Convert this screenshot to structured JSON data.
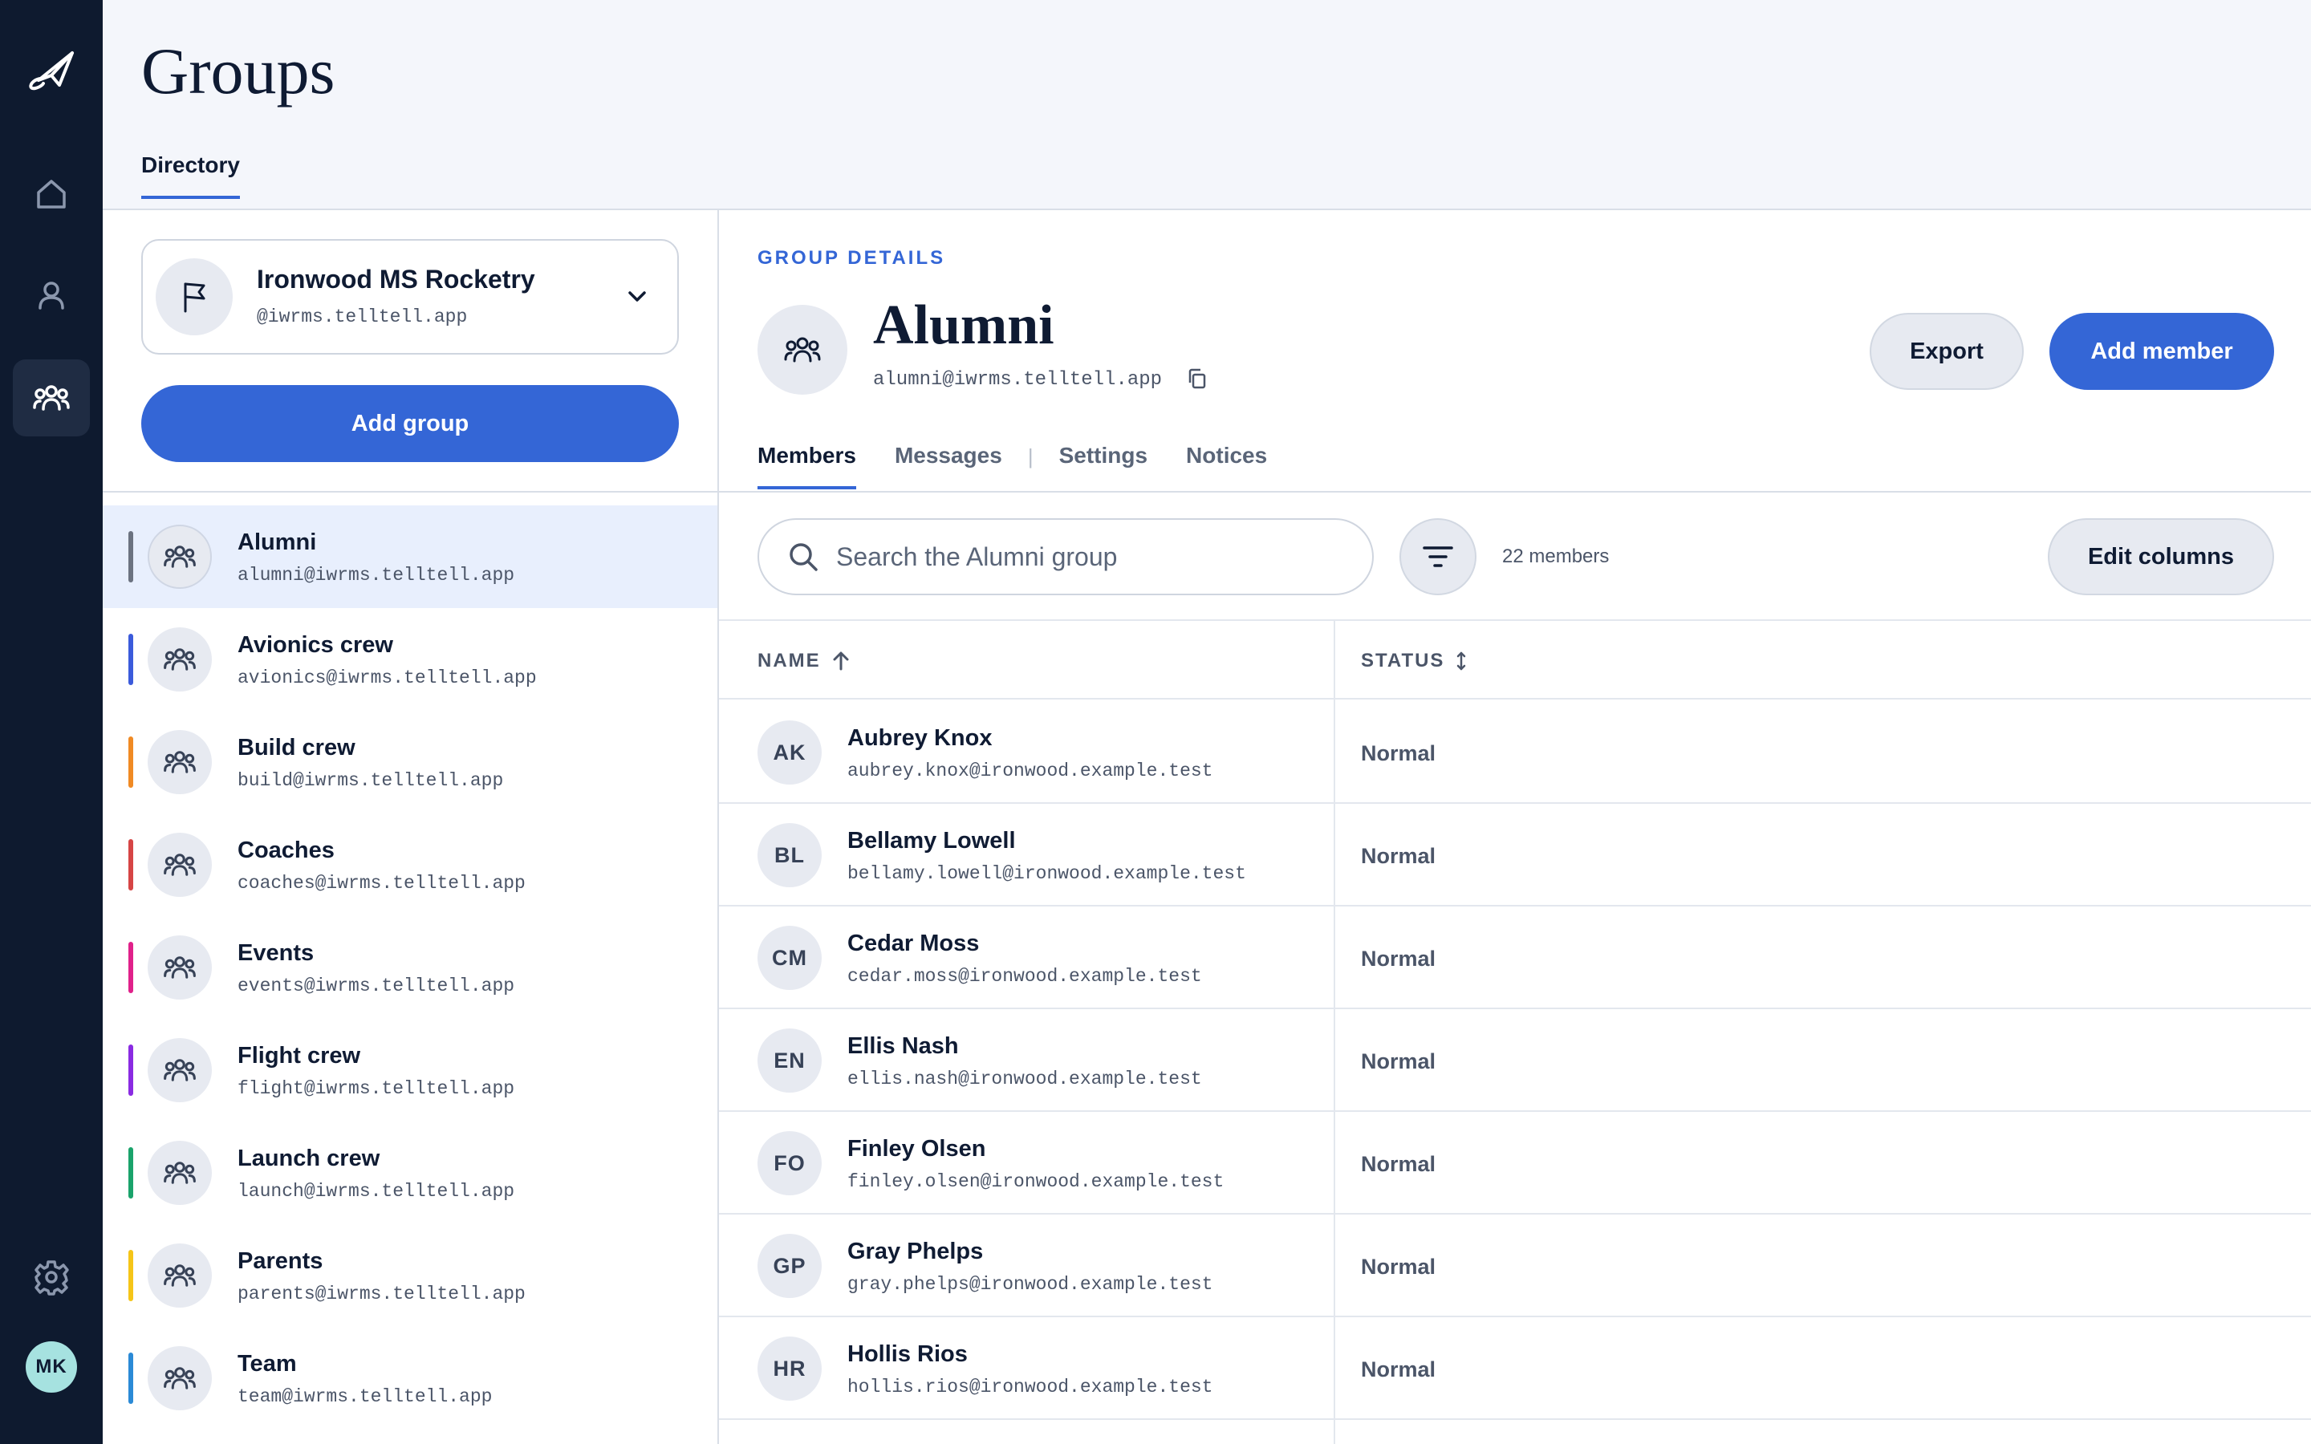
{
  "app": {
    "logo_icon": "rocket-icon",
    "accent": "#3466d6",
    "rail_bg": "#0e1a2f"
  },
  "rail": {
    "items": [
      {
        "icon": "home-icon"
      },
      {
        "icon": "person-icon"
      },
      {
        "icon": "people-icon",
        "active": true
      },
      {
        "icon": "gear-icon"
      }
    ],
    "avatar_initials": "MK"
  },
  "header": {
    "title": "Groups",
    "tab": "Directory"
  },
  "org": {
    "name": "Ironwood MS Rocketry",
    "handle": "@iwrms.telltell.app",
    "icon": "flag-icon"
  },
  "left": {
    "add_group_label": "Add group",
    "groups": [
      {
        "name": "Alumni",
        "email": "alumni@iwrms.telltell.app",
        "color": "#6b7280",
        "selected": true
      },
      {
        "name": "Avionics crew",
        "email": "avionics@iwrms.telltell.app",
        "color": "#3b5bdb"
      },
      {
        "name": "Build crew",
        "email": "build@iwrms.telltell.app",
        "color": "#f08a24"
      },
      {
        "name": "Coaches",
        "email": "coaches@iwrms.telltell.app",
        "color": "#d64545"
      },
      {
        "name": "Events",
        "email": "events@iwrms.telltell.app",
        "color": "#e0218a"
      },
      {
        "name": "Flight crew",
        "email": "flight@iwrms.telltell.app",
        "color": "#8a2be2"
      },
      {
        "name": "Launch crew",
        "email": "launch@iwrms.telltell.app",
        "color": "#1aa36b"
      },
      {
        "name": "Parents",
        "email": "parents@iwrms.telltell.app",
        "color": "#f5c518"
      },
      {
        "name": "Team",
        "email": "team@iwrms.telltell.app",
        "color": "#2b8ad6"
      }
    ]
  },
  "detail": {
    "section_label": "GROUP DETAILS",
    "name": "Alumni",
    "email": "alumni@iwrms.telltell.app",
    "export_label": "Export",
    "add_member_label": "Add member",
    "tabs": [
      "Members",
      "Messages",
      "Settings",
      "Notices"
    ],
    "tab_separator": "|",
    "search_placeholder": "Search the Alumni group",
    "member_count": "22 members",
    "edit_columns_label": "Edit columns",
    "columns": {
      "name": "NAME",
      "status": "STATUS"
    },
    "members": [
      {
        "initials": "AK",
        "name": "Aubrey Knox",
        "email": "aubrey.knox@ironwood.example.test",
        "status": "Normal"
      },
      {
        "initials": "BL",
        "name": "Bellamy Lowell",
        "email": "bellamy.lowell@ironwood.example.test",
        "status": "Normal"
      },
      {
        "initials": "CM",
        "name": "Cedar Moss",
        "email": "cedar.moss@ironwood.example.test",
        "status": "Normal"
      },
      {
        "initials": "EN",
        "name": "Ellis Nash",
        "email": "ellis.nash@ironwood.example.test",
        "status": "Normal"
      },
      {
        "initials": "FO",
        "name": "Finley Olsen",
        "email": "finley.olsen@ironwood.example.test",
        "status": "Normal"
      },
      {
        "initials": "GP",
        "name": "Gray Phelps",
        "email": "gray.phelps@ironwood.example.test",
        "status": "Normal"
      },
      {
        "initials": "HR",
        "name": "Hollis Rios",
        "email": "hollis.rios@ironwood.example.test",
        "status": "Normal"
      }
    ]
  }
}
